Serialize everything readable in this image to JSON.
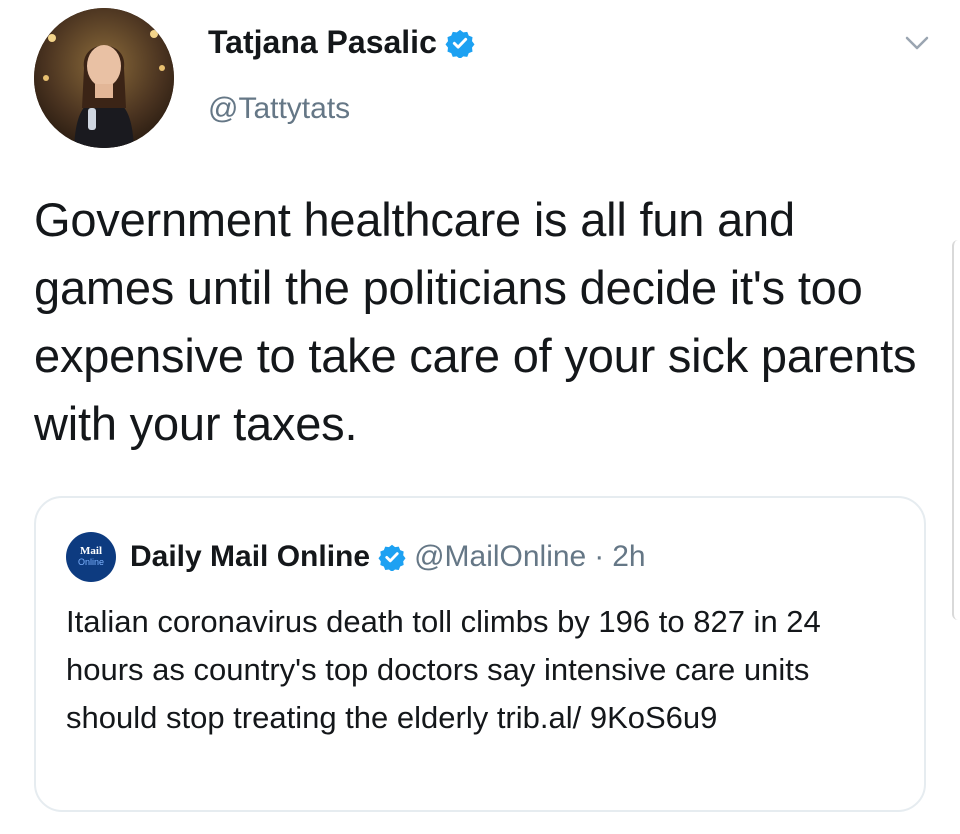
{
  "tweet": {
    "author": {
      "name": "Tatjana Pasalic",
      "handle": "@Tattytats",
      "verified": true
    },
    "text": "Government healthcare is all fun and games until the politicians decide it's too expensive to take care of your sick parents with your taxes.",
    "menu_icon": "chevron-down-icon"
  },
  "quoted_tweet": {
    "logo_text_top": "Mail",
    "logo_text_bottom": "Online",
    "author_name": "Daily Mail Online",
    "verified": true,
    "handle": "@MailOnline",
    "separator": "·",
    "time": "2h",
    "text": "Italian coronavirus death toll climbs by 196 to 827 in 24 hours as country's top doctors say intensive care units should stop treating the elderly trib.al/ 9KoS6u9"
  },
  "colors": {
    "verified_blue": "#1da1f2",
    "secondary_text": "#657786",
    "border": "#e6ecf0",
    "chevron": "#9aa5b1"
  }
}
